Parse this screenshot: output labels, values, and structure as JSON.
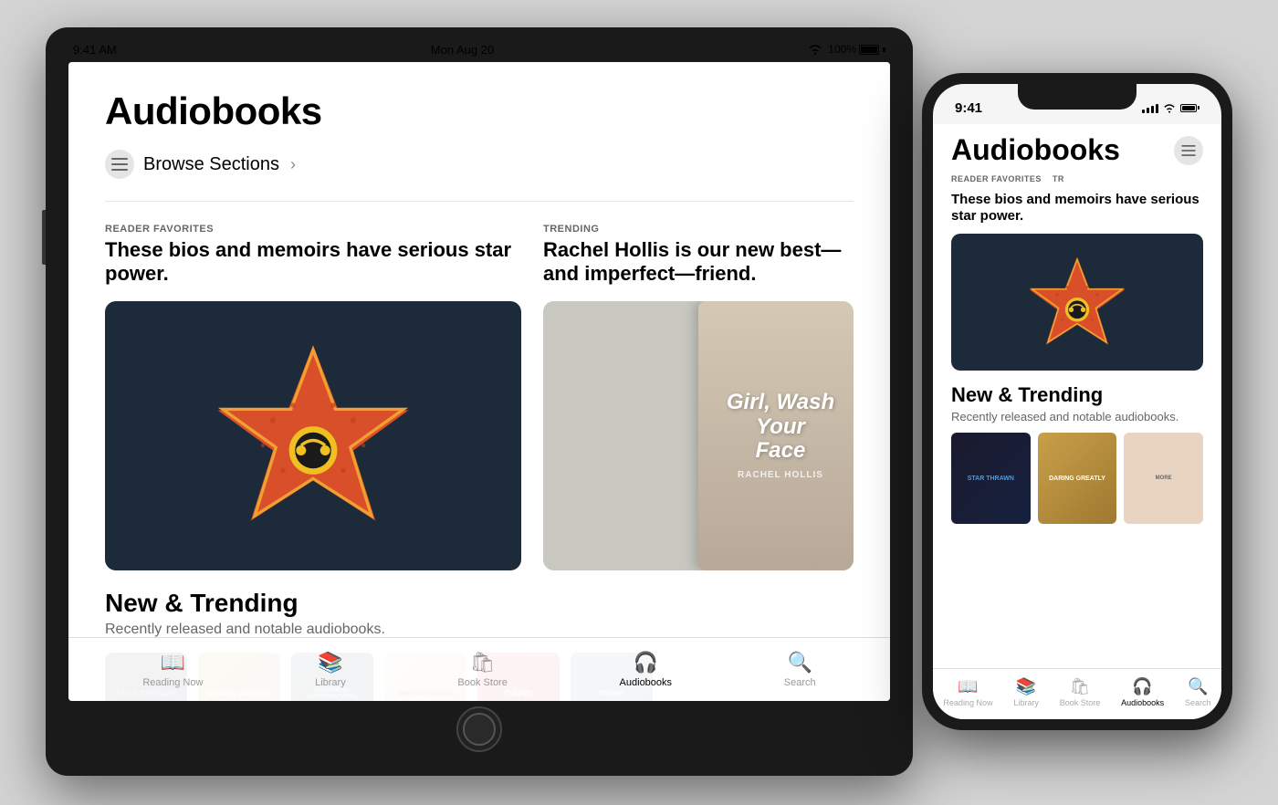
{
  "scene": {
    "background": "#d4d4d4"
  },
  "ipad": {
    "status_bar": {
      "time": "9:41 AM",
      "date": "Mon Aug 20",
      "wifi": true,
      "battery": "100%"
    },
    "screen": {
      "page_title": "Audiobooks",
      "browse_sections_label": "Browse Sections",
      "sections": [
        {
          "tag": "READER FAVORITES",
          "title": "These bios and memoirs have serious star power.",
          "image_type": "star_cover"
        },
        {
          "tag": "TRENDING",
          "title": "Rachel Hollis is our new best—and imperfect—friend.",
          "image_type": "girl_wash_face"
        }
      ],
      "new_trending": {
        "title": "New & Trending",
        "subtitle": "Recently released and notable audiobooks."
      },
      "books": [
        {
          "color": "star_wars",
          "label": "Star Wars"
        },
        {
          "color": "daring",
          "label": "Daring Greatly"
        },
        {
          "color": "supernatural",
          "label": "Becoming Supernatural"
        },
        {
          "color": "dinesh",
          "label": "Dinesh D'Souza"
        },
        {
          "color": "david",
          "label": "David"
        },
        {
          "color": "stuart",
          "label": "Stuart"
        }
      ]
    },
    "tab_bar": {
      "tabs": [
        {
          "icon": "📖",
          "label": "Reading Now",
          "active": false
        },
        {
          "icon": "📚",
          "label": "Library",
          "active": false
        },
        {
          "icon": "🛍",
          "label": "Book Store",
          "active": false
        },
        {
          "icon": "🎧",
          "label": "Audiobooks",
          "active": true
        },
        {
          "icon": "🔍",
          "label": "Search",
          "active": false
        }
      ]
    }
  },
  "iphone": {
    "status_bar": {
      "time": "9:41",
      "signal": true,
      "wifi": true,
      "battery": true
    },
    "screen": {
      "page_title": "Audiobooks",
      "reader_favorites_tag": "READER FAVORITES",
      "reader_favorites_title": "These bios and memoirs have serious star power.",
      "trending_tag": "TR",
      "new_trending_title": "New & Trending",
      "new_trending_subtitle": "Recently released and notable audiobooks."
    },
    "tab_bar": {
      "tabs": [
        {
          "label": "Reading Now",
          "active": false
        },
        {
          "label": "Library",
          "active": false
        },
        {
          "label": "Book Store",
          "active": false
        },
        {
          "label": "Audiobooks",
          "active": true
        },
        {
          "label": "Search",
          "active": false
        }
      ]
    }
  }
}
